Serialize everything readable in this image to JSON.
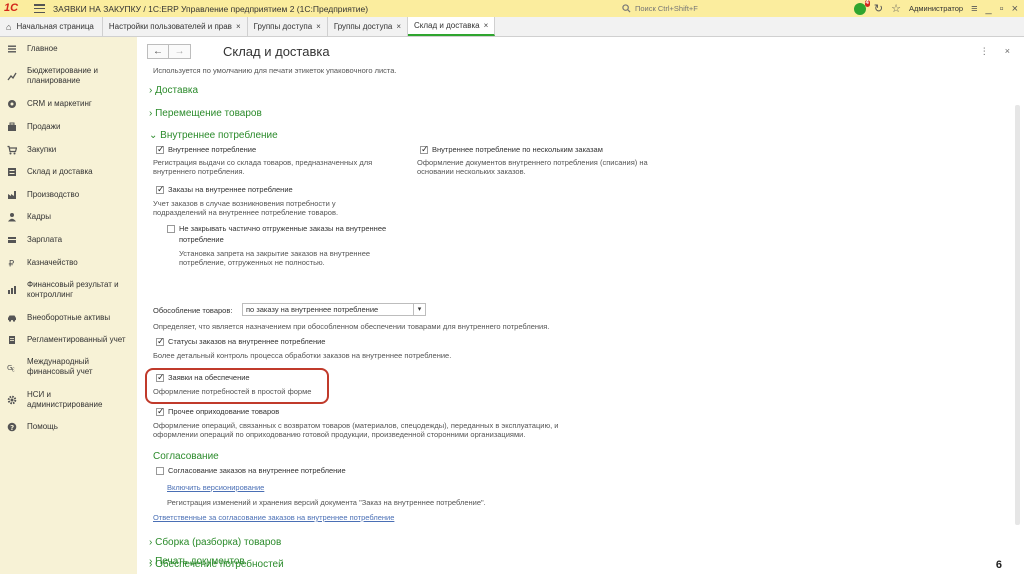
{
  "titlebar": {
    "logo": "1С",
    "title": "ЗАЯВКИ НА ЗАКУПКУ / 1С:ERP Управление предприятием 2  (1С:Предприятие)",
    "search_placeholder": "Поиск Ctrl+Shift+F",
    "notif_count": "4",
    "user": "Администратор"
  },
  "tabs": [
    {
      "label": "Начальная страница"
    },
    {
      "label": "Настройки пользователей и прав"
    },
    {
      "label": "Группы доступа"
    },
    {
      "label": "Группы доступа"
    },
    {
      "label": "Склад и доставка"
    }
  ],
  "sidebar": {
    "items": [
      {
        "label": "Главное",
        "icon": "menu-icon"
      },
      {
        "label": "Бюджетирование и",
        "label2": "планирование",
        "icon": "budget-icon"
      },
      {
        "label": "CRM и маркетинг",
        "icon": "crm-icon"
      },
      {
        "label": "Продажи",
        "icon": "sales-icon"
      },
      {
        "label": "Закупки",
        "icon": "cart-icon"
      },
      {
        "label": "Склад и доставка",
        "icon": "warehouse-icon"
      },
      {
        "label": "Производство",
        "icon": "factory-icon"
      },
      {
        "label": "Кадры",
        "icon": "person-icon"
      },
      {
        "label": "Зарплата",
        "icon": "salary-icon"
      },
      {
        "label": "Казначейство",
        "icon": "treasury-icon"
      },
      {
        "label": "Финансовый результат и",
        "label2": "контроллинг",
        "icon": "chart-icon"
      },
      {
        "label": "Внеоборотные активы",
        "icon": "car-icon"
      },
      {
        "label": "Регламентированный учет",
        "icon": "document-icon"
      },
      {
        "label": "Международный",
        "label2": "финансовый учет",
        "icon": "international-icon"
      },
      {
        "label": "НСИ и",
        "label2": "администрирование",
        "icon": "gear-icon"
      },
      {
        "label": "Помощь",
        "icon": "help-icon"
      }
    ]
  },
  "page": {
    "title": "Склад и доставка",
    "back": "←",
    "forward": "→",
    "more": "⋮",
    "close": "×"
  },
  "content": {
    "top_note": "Используется по умолчанию для печати этикеток упаковочного листа.",
    "sec_delivery": "Доставка",
    "sec_move": "Перемещение товаров",
    "sec_internal": "Внутреннее потребление",
    "cb_internal": "Внутреннее потребление",
    "cb_internal_desc1": "Регистрация выдачи со склада товаров, предназначенных для",
    "cb_internal_desc2": "внутреннего потребления.",
    "cb_multi": "Внутреннее потребление по нескольким заказам",
    "cb_multi_desc1": "Оформление документов внутреннего потребления (списания) на",
    "cb_multi_desc2": "основании нескольких заказов.",
    "cb_orders": "Заказы на внутреннее потребление",
    "cb_orders_desc1": "Учет заказов в случае возникновения потребности у",
    "cb_orders_desc2": "подразделений на внутреннее потребление товаров.",
    "cb_noclose": "Не закрывать частично отгруженные заказы на внутреннее",
    "cb_noclose2": "потребление",
    "cb_noclose_desc1": "Установка запрета на закрытие заказов на внутреннее",
    "cb_noclose_desc2": "потребление, отгруженных не полностью.",
    "provision_label": "Обособление товаров:",
    "provision_value": "по заказу на внутреннее потребление",
    "provision_desc": "Определяет, что является назначением при обособленном обеспечении товарами для внутреннего потребления.",
    "cb_status": "Статусы заказов на внутреннее потребление",
    "cb_status_desc": "Более детальный контроль процесса обработки заказов на внутреннее потребление.",
    "cb_requests": "Заявки на обеспечение",
    "cb_requests_desc": "Оформление потребностей в простой форме",
    "cb_other": "Прочее оприходование товаров",
    "cb_other_desc1": "Оформление операций, связанных с возвратом товаров (материалов, спецодежды), переданных в эксплуатацию, и",
    "cb_other_desc2": "оформлении операций по оприходованию готовой продукции, произведенной сторонними организациями.",
    "sec_approval": "Согласование",
    "cb_approval": "Согласование заказов на внутреннее потребление",
    "link_versioning": "Включить версионирование",
    "versioning_desc": "Регистрация изменений и хранения версий документа \"Заказ на внутреннее потребление\".",
    "link_responsible": "Ответственные за согласование заказов на внутреннее потребление",
    "sec_assembly": "Сборка (разборка) товаров",
    "sec_provision": "Обеспечение потребностей",
    "sec_print": "Печать документов"
  },
  "page_number": "6"
}
